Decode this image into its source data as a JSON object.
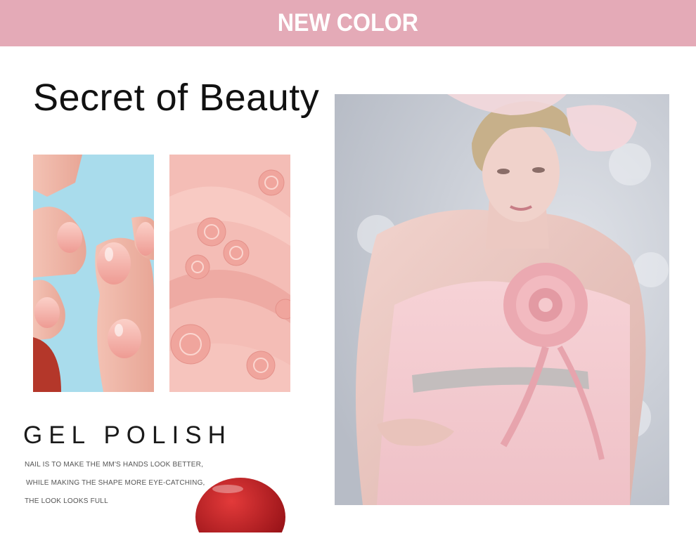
{
  "banner": {
    "title": "NEW COLOR",
    "background": "#e4aab7"
  },
  "headline": "Secret of Beauty",
  "product": {
    "title": "GEL POLISH",
    "description": [
      "NAIL IS TO MAKE THE MM'S HANDS LOOK BETTER,",
      "WHILE MAKING THE SHAPE MORE EYE-CATCHING,",
      "THE LOOK LOOKS FULL"
    ]
  },
  "images": {
    "nails": "pink-manicure-photo",
    "fabric": "pink-rosette-fabric-photo",
    "model": "model-in-pink-dress-photo",
    "bottle": "red-polish-bottle-cap"
  },
  "colors": {
    "accent_pink": "#e4aab7",
    "nail_pink": "#f2aaa3",
    "polish_red": "#b0121a"
  }
}
